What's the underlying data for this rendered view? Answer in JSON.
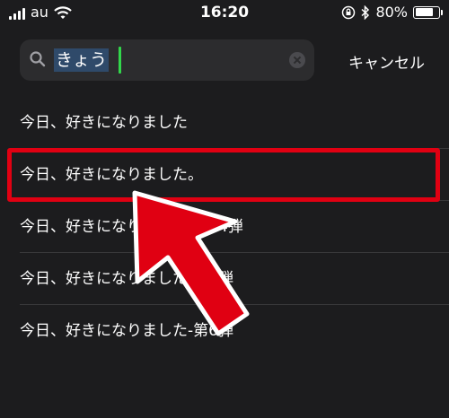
{
  "status_bar": {
    "carrier": "au",
    "time": "16:20",
    "battery_percent": "80%",
    "battery_level": 0.8
  },
  "search": {
    "query": "きょう",
    "cancel_label": "キャンセル"
  },
  "results": [
    "今日、好きになりました",
    "今日、好きになりました。",
    "今日、好きになりました-第14弾",
    "今日、好きになりました-第9弾",
    "今日、好きになりました-第6弾"
  ],
  "annotation": {
    "highlight_color": "#e00012",
    "arrow_color": "#e00012"
  }
}
